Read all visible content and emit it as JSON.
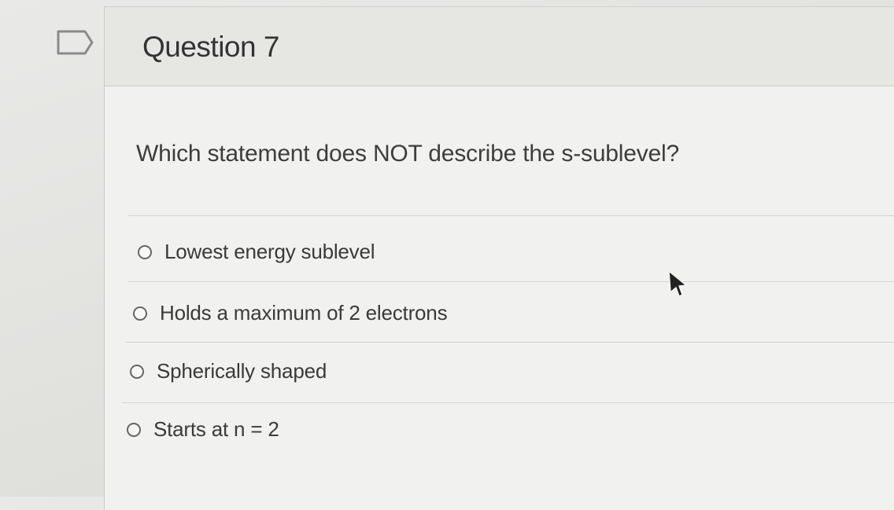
{
  "question": {
    "title": "Question 7",
    "prompt": "Which statement does NOT describe the s-sublevel?",
    "answers": [
      {
        "label": "Lowest energy sublevel"
      },
      {
        "label": "Holds a maximum of 2 electrons"
      },
      {
        "label": "Spherically shaped"
      },
      {
        "label": "Starts at n = 2"
      }
    ]
  },
  "icons": {
    "flag": "flag-outline-icon",
    "radio": "radio-unselected-icon",
    "cursor": "mouse-pointer-icon"
  },
  "colors": {
    "background": "#e4e4e1",
    "card": "#f1f1ef",
    "header": "#e6e6e3",
    "text": "#3e3e3e"
  }
}
